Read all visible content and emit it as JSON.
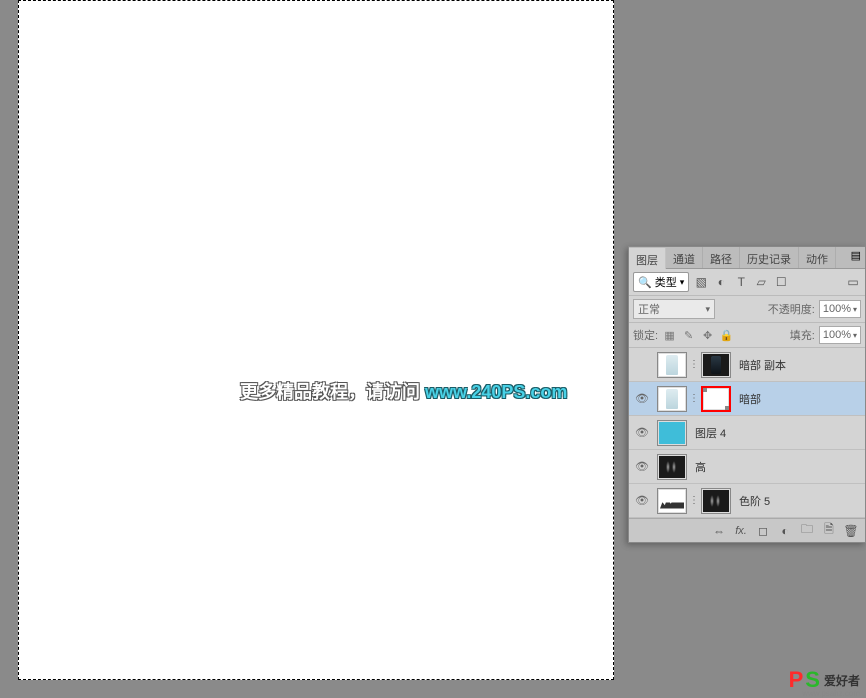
{
  "watermark": {
    "text": "更多精品教程，请访问 ",
    "link": "www.240PS.com"
  },
  "panel": {
    "tabs": [
      "图层",
      "通道",
      "路径",
      "历史记录",
      "动作"
    ],
    "filter_label": "类型",
    "blend_mode": "正常",
    "opacity_label": "不透明度:",
    "opacity_value": "100%",
    "lock_label": "锁定:",
    "fill_label": "填充:",
    "fill_value": "100%"
  },
  "layers": [
    {
      "name": "暗部 副本",
      "selected": false,
      "vis": false,
      "thumb": "bottle",
      "mask": "dark-bottle"
    },
    {
      "name": "暗部",
      "selected": true,
      "vis": true,
      "thumb": "bottle",
      "mask": "white-red"
    },
    {
      "name": "图层 4",
      "selected": false,
      "vis": true,
      "thumb": "cyan",
      "mask": null
    },
    {
      "name": "高",
      "selected": false,
      "vis": true,
      "thumb": "dark-frag",
      "mask": null
    },
    {
      "name": "色阶 5",
      "selected": false,
      "vis": true,
      "thumb": "histogram",
      "mask": "dark-frag"
    }
  ],
  "logo": {
    "p": "P",
    "s": "S",
    "text": "爱好者",
    "url": "www.psahz.com"
  }
}
